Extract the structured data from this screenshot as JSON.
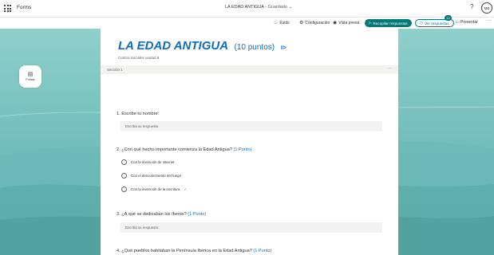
{
  "topbar": {
    "app_name": "Forms",
    "doc_title": "LA EDAD ANTIGUA",
    "saved_status": "- Guardado",
    "help": "?",
    "avatar_initials": "MB"
  },
  "commandbar": {
    "style": "Estilo",
    "settings": "Configuración",
    "preview": "Vista previa",
    "collect": "Recopilar respuestas",
    "responses": "Ver respuestas",
    "responses_count": "12",
    "present": "Presentar",
    "more": "···"
  },
  "side_tool": {
    "label": "Puntos"
  },
  "form": {
    "title": "LA EDAD ANTIGUA",
    "points": "(10 puntos)",
    "subtitle": "Control Sociales unidad 6",
    "section": "Sección 1",
    "section_more": "···",
    "questions": [
      {
        "label": "1. Escribe tu nombre:",
        "placeholder": "Escriba su respuesta"
      },
      {
        "label": "2. ¿Con qué hecho importante comienza la Edad Antigua?",
        "points": "(1 Punto)",
        "options": [
          "Con la invención de internet",
          "Con el descubrimiento del fuego",
          "Con la invención de la escritura"
        ]
      },
      {
        "label": "3. ¿A qué se dedicaban los íberos?",
        "points": "(1 Punto)",
        "placeholder": "Escriba su respuesta"
      },
      {
        "label": "4. ¿Qué pueblos habitaban la Península Ibérica en la Edad Antigua?",
        "points": "(1 Punto)"
      }
    ]
  },
  "colors": {
    "accent": "#03787c",
    "title_blue": "#0f6cbd",
    "bg_teal": "#78c1be"
  }
}
